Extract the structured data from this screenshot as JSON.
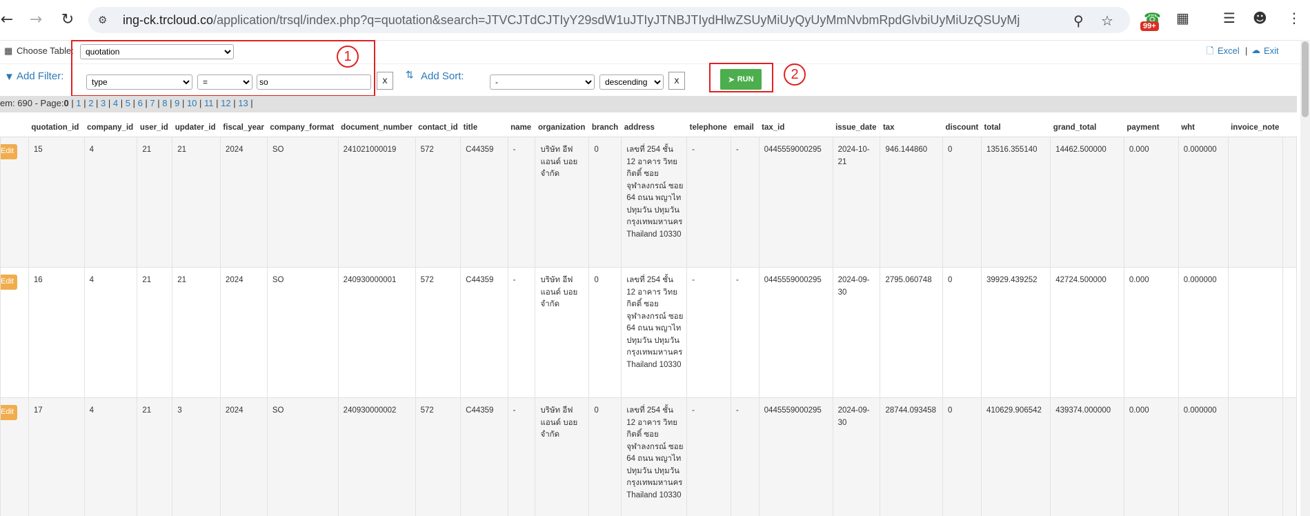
{
  "browser": {
    "url_host": "ing-ck.trcloud.co",
    "url_rest": "/application/trsql/index.php?q=quotation&search=JTVCJTdCJTIyY29sdW1uJTIyJTNBJTIydHlwZSUyMiUyQyUyMmNvbmRpdGlvbiUyMiUzQSUyMjIlMk...",
    "ext_badge": "99+"
  },
  "toolbar": {
    "choose_table_label": "Choose Table:",
    "table_selected": "quotation",
    "excel_label": "Excel",
    "separator": "|",
    "exit_label": "Exit",
    "add_filter_label": "Add Filter:",
    "filter_column": "type",
    "filter_operator": "=",
    "filter_value": "so",
    "remove_label": "x",
    "add_sort_label": "Add Sort:",
    "sort_column": "-",
    "sort_direction": "descending",
    "run_label": "RUN"
  },
  "annotations": {
    "marker1": "1",
    "marker2": "2"
  },
  "pager": {
    "prefix": "em: 690 - Page:",
    "current": "0",
    "pages": [
      "1",
      "2",
      "3",
      "4",
      "5",
      "6",
      "7",
      "8",
      "9",
      "10",
      "11",
      "12",
      "13"
    ]
  },
  "table": {
    "edit_label": "Edit",
    "headers": [
      "",
      "quotation_id",
      "company_id",
      "user_id",
      "updater_id",
      "fiscal_year",
      "company_format",
      "document_number",
      "contact_id",
      "title",
      "name",
      "organization",
      "branch",
      "address",
      "telephone",
      "email",
      "tax_id",
      "issue_date",
      "tax",
      "discount",
      "total",
      "grand_total",
      "payment",
      "wht",
      "invoice_note",
      ""
    ],
    "rows": [
      [
        "15",
        "4",
        "21",
        "21",
        "2024",
        "SO",
        "241021000019",
        "572",
        "C44359",
        "-",
        "บริษัท อีฟ แอนด์ บอย จำกัด",
        "0",
        "เลขที่ 254 ชั้น 12 อาคาร วิทยกิตติ์ ซอย จุฬาลงกรณ์ ซอย 64 ถนน พญาไท ปทุมวัน ปทุมวัน กรุงเทพมหานคร Thailand 10330",
        "-",
        "-",
        "0445559000295",
        "2024-10-21",
        "946.144860",
        "0",
        "13516.355140",
        "14462.500000",
        "0.000",
        "0.000000",
        ""
      ],
      [
        "16",
        "4",
        "21",
        "21",
        "2024",
        "SO",
        "240930000001",
        "572",
        "C44359",
        "-",
        "บริษัท อีฟ แอนด์ บอย จำกัด",
        "0",
        "เลขที่ 254 ชั้น 12 อาคาร วิทยกิตติ์ ซอย จุฬาลงกรณ์ ซอย 64 ถนน พญาไท ปทุมวัน ปทุมวัน กรุงเทพมหานคร Thailand 10330",
        "-",
        "-",
        "0445559000295",
        "2024-09-30",
        "2795.060748",
        "0",
        "39929.439252",
        "42724.500000",
        "0.000",
        "0.000000",
        ""
      ],
      [
        "17",
        "4",
        "21",
        "3",
        "2024",
        "SO",
        "240930000002",
        "572",
        "C44359",
        "-",
        "บริษัท อีฟ แอนด์ บอย จำกัด",
        "0",
        "เลขที่ 254 ชั้น 12 อาคาร วิทยกิตติ์ ซอย จุฬาลงกรณ์ ซอย 64 ถนน พญาไท ปทุมวัน ปทุมวัน กรุงเทพมหานคร Thailand 10330",
        "-",
        "-",
        "0445559000295",
        "2024-09-30",
        "28744.093458",
        "0",
        "410629.906542",
        "439374.000000",
        "0.000",
        "0.000000",
        ""
      ]
    ]
  }
}
